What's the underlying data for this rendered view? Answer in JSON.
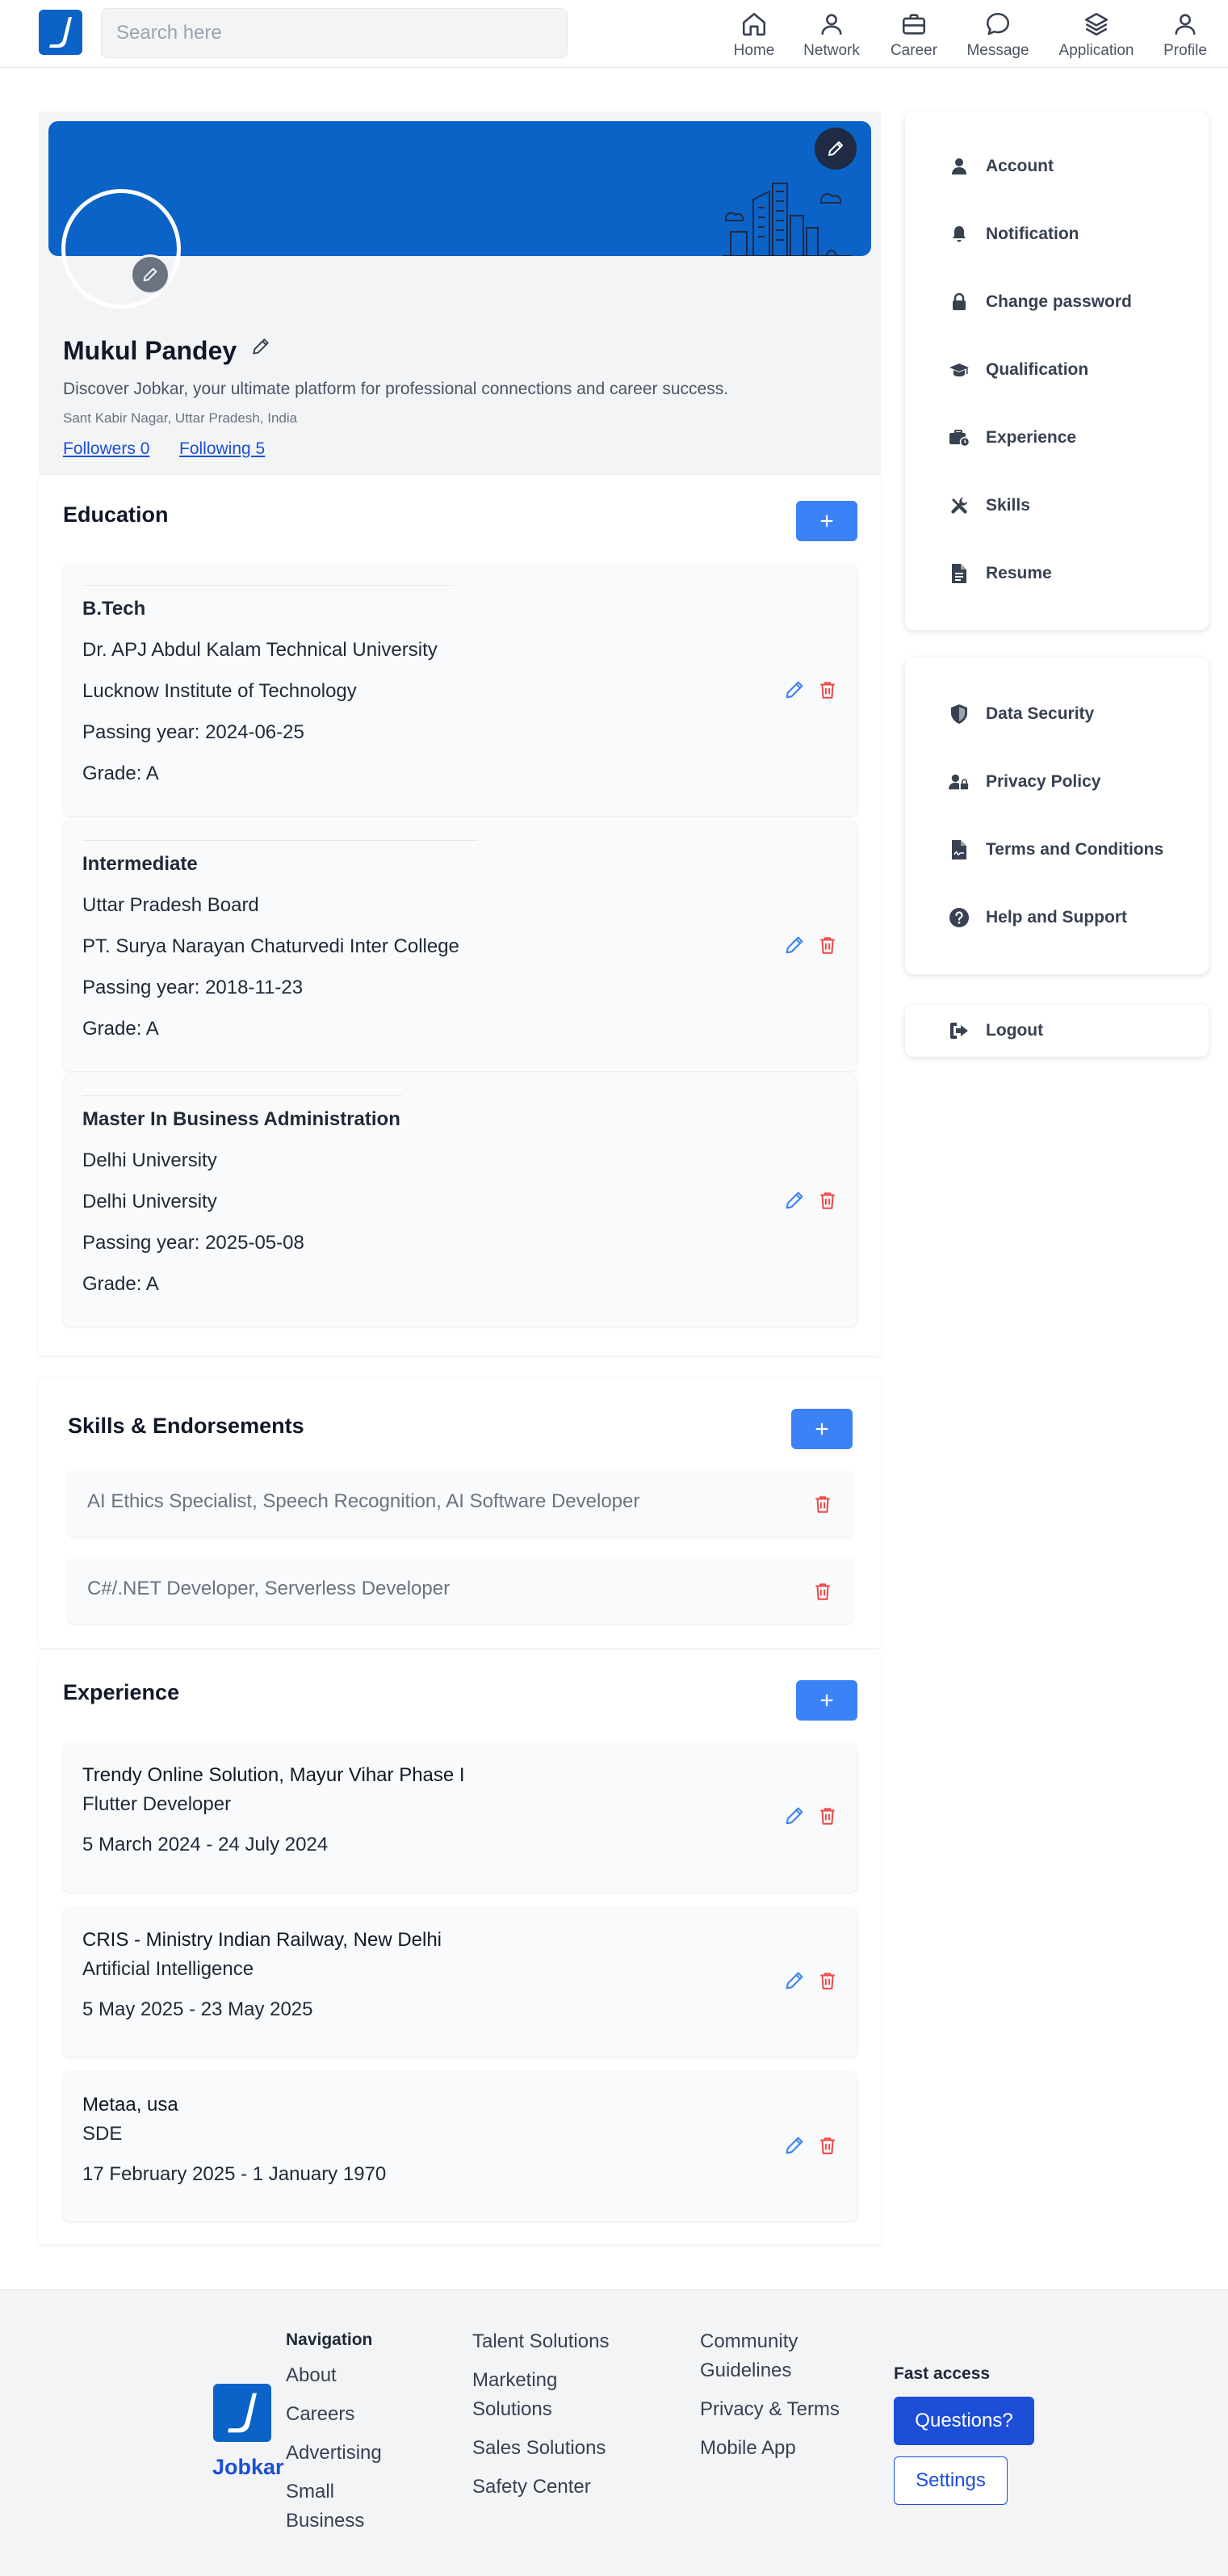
{
  "header": {
    "search_placeholder": "Search here",
    "nav": [
      {
        "label": "Home",
        "icon": "home-icon"
      },
      {
        "label": "Network",
        "icon": "person-icon"
      },
      {
        "label": "Career",
        "icon": "briefcase-icon"
      },
      {
        "label": "Message",
        "icon": "chat-icon"
      },
      {
        "label": "Application",
        "icon": "layers-icon"
      },
      {
        "label": "Profile",
        "icon": "user-icon"
      }
    ]
  },
  "profile": {
    "name": "Mukul Pandey",
    "tagline": "Discover Jobkar, your ultimate platform for professional connections and career success.",
    "location": "Sant Kabir Nagar, Uttar Pradesh, India",
    "followers_label": "Followers 0",
    "following_label": "Following 5"
  },
  "education": {
    "title": "Education",
    "items": [
      {
        "degree": "B.Tech",
        "board": "Dr. APJ Abdul Kalam Technical University",
        "institute": "Lucknow Institute of Technology",
        "passing": "Passing year: 2024-06-25",
        "grade": "Grade: A"
      },
      {
        "degree": "Intermediate",
        "board": "Uttar Pradesh Board",
        "institute": "PT. Surya Narayan Chaturvedi Inter College",
        "passing": "Passing year: 2018-11-23",
        "grade": "Grade: A"
      },
      {
        "degree": "Master In Business Administration",
        "board": "Delhi University",
        "institute": "Delhi University",
        "passing": "Passing year: 2025-05-08",
        "grade": "Grade: A"
      }
    ]
  },
  "skills": {
    "title": "Skills & Endorsements",
    "items": [
      "AI Ethics Specialist, Speech Recognition, AI Software Developer",
      "C#/.NET Developer, Serverless Developer"
    ]
  },
  "experience": {
    "title": "Experience",
    "items": [
      {
        "company": "Trendy Online Solution, Mayur Vihar Phase I",
        "role": "Flutter Developer",
        "dates": "5 March 2024 - 24 July 2024"
      },
      {
        "company": "CRIS - Ministry Indian Railway, New Delhi",
        "role": "Artificial Intelligence",
        "dates": "5 May 2025 - 23 May 2025"
      },
      {
        "company": "Metaa, usa",
        "role": "SDE",
        "dates": "17 February 2025 - 1 January 1970"
      }
    ]
  },
  "sidebar": {
    "group1": [
      {
        "label": "Account",
        "icon": "user-icon"
      },
      {
        "label": "Notification",
        "icon": "bell-icon"
      },
      {
        "label": "Change password",
        "icon": "lock-icon"
      },
      {
        "label": "Qualification",
        "icon": "graduation-cap-icon"
      },
      {
        "label": "Experience",
        "icon": "briefcase-clock-icon"
      },
      {
        "label": "Skills",
        "icon": "tools-icon"
      },
      {
        "label": "Resume",
        "icon": "document-icon"
      }
    ],
    "group2": [
      {
        "label": "Data Security",
        "icon": "shield-icon"
      },
      {
        "label": "Privacy Policy",
        "icon": "user-lock-icon"
      },
      {
        "label": "Terms and Conditions",
        "icon": "file-signature-icon"
      },
      {
        "label": "Help and Support",
        "icon": "question-circle-icon"
      }
    ],
    "logout": {
      "label": "Logout",
      "icon": "logout-icon"
    }
  },
  "footer": {
    "brand": "Jobkar",
    "nav_heading": "Navigation",
    "col1": [
      "About",
      "Careers",
      "Advertising",
      "Small Business"
    ],
    "col2": [
      "Talent Solutions",
      "Marketing Solutions",
      "Sales Solutions",
      "Safety Center"
    ],
    "col3": [
      "Community Guidelines",
      "Privacy & Terms",
      "Mobile App"
    ],
    "fast_heading": "Fast access",
    "btn_questions": "Questions?",
    "btn_settings": "Settings"
  },
  "colors": {
    "brand_blue": "#0b63c7",
    "accent_blue": "#3b82f6",
    "delete_red": "#ef4444",
    "link_blue": "#1d4ed8"
  }
}
